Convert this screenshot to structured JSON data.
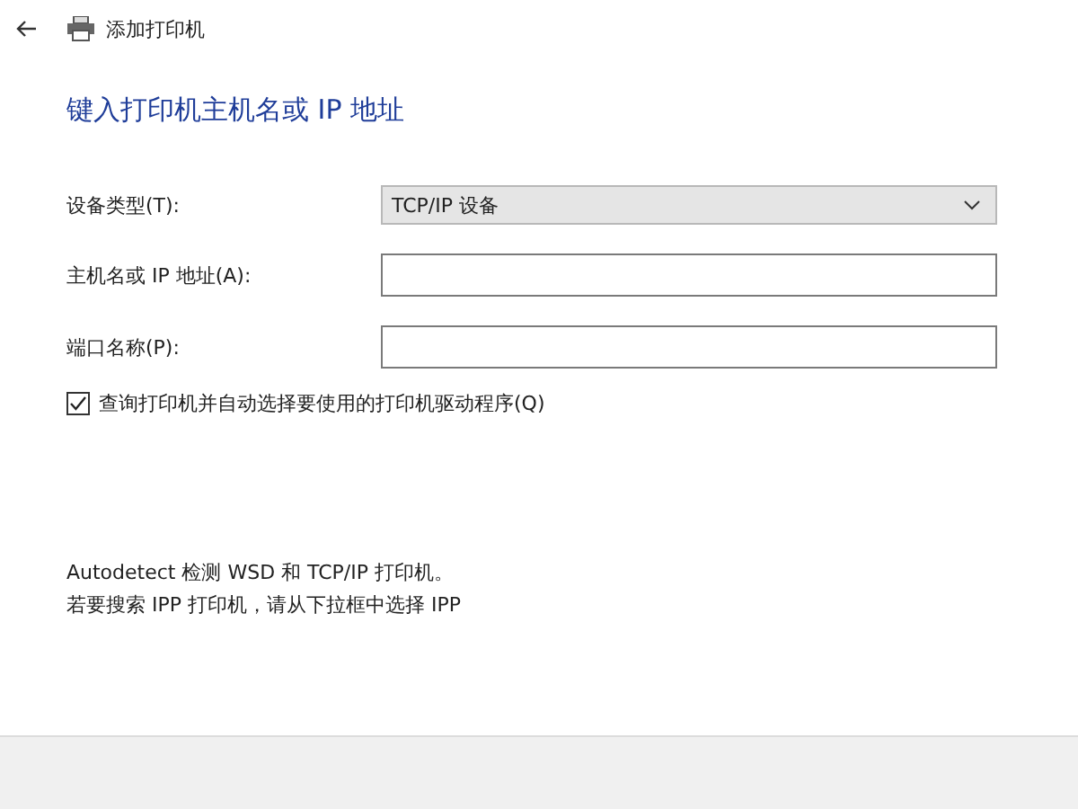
{
  "window": {
    "title": "添加打印机"
  },
  "heading": "键入打印机主机名或 IP 地址",
  "fields": [
    {
      "kind": "dropdown",
      "label": "设备类型(T):",
      "value": "TCP/IP 设备"
    },
    {
      "kind": "text",
      "label": "主机名或 IP 地址(A):"
    },
    {
      "kind": "text",
      "label": "端口名称(P):"
    }
  ],
  "query_checkbox": {
    "label": "查询打印机并自动选择要使用的打印机驱动程序(Q)",
    "checked": true
  },
  "info": [
    "Autodetect 检测 WSD 和 TCP/IP 打印机。",
    "若要搜索 IPP 打印机，请从下拉框中选择 IPP"
  ]
}
